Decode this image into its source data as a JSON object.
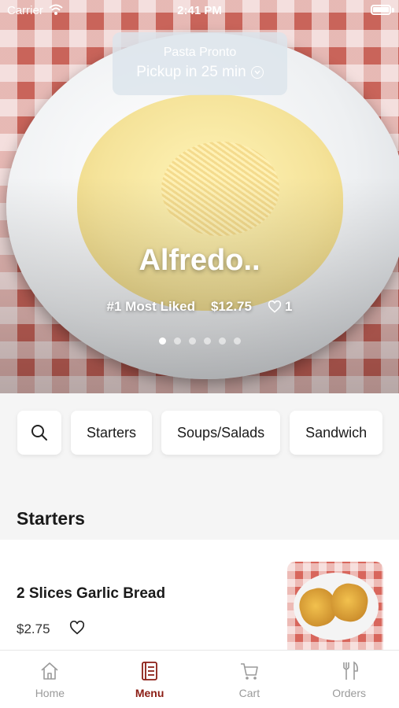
{
  "status_bar": {
    "carrier": "Carrier",
    "time": "2:41 PM"
  },
  "pickup": {
    "restaurant": "Pasta Pronto",
    "eta": "Pickup in 25 min"
  },
  "featured": {
    "title": "Alfredo..",
    "badge": "#1 Most Liked",
    "price": "$12.75",
    "likes": "1",
    "carousel_count": 6,
    "carousel_active": 0
  },
  "categories": [
    "Starters",
    "Soups/Salads",
    "Sandwich"
  ],
  "section": {
    "title": "Starters"
  },
  "items": [
    {
      "name": "2 Slices Garlic Bread",
      "price": "$2.75"
    }
  ],
  "tabs": [
    {
      "label": "Home",
      "icon": "home-icon",
      "active": false
    },
    {
      "label": "Menu",
      "icon": "menu-book-icon",
      "active": true
    },
    {
      "label": "Cart",
      "icon": "cart-icon",
      "active": false
    },
    {
      "label": "Orders",
      "icon": "fork-knife-icon",
      "active": false
    }
  ],
  "colors": {
    "accent": "#8b1d14",
    "tab_inactive": "#9a9a9a"
  }
}
